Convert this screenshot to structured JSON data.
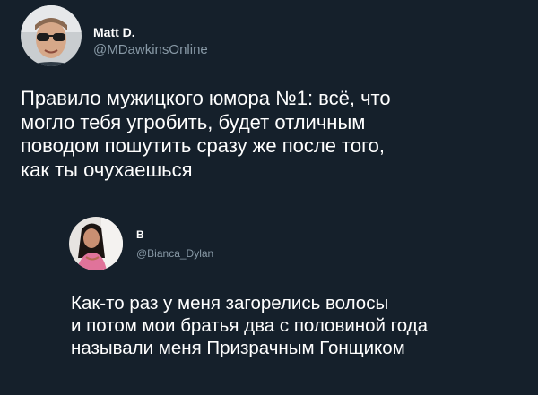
{
  "tweet": {
    "author": {
      "name": "Matt D.",
      "handle": "@MDawkinsOnline"
    },
    "text_lines": [
      "Правило мужицкого юмора №1: всё, что",
      "могло тебя угробить, будет отличным",
      "поводом пошутить сразу же после того,",
      "как ты очухаешься"
    ]
  },
  "reply": {
    "author": {
      "name": "B",
      "handle": "@Bianca_Dylan"
    },
    "text_lines": [
      "Как-то раз у меня загорелись волосы",
      "и потом мои братья два с половиной года",
      "называли меня Призрачным Гонщиком"
    ]
  }
}
